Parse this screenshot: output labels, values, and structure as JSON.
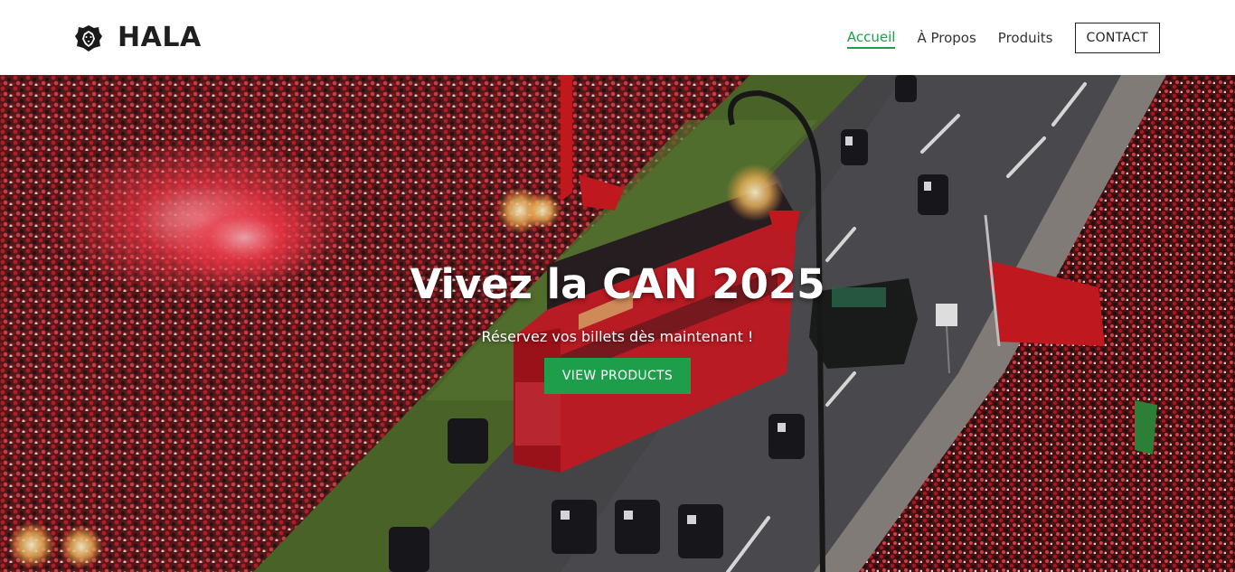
{
  "brand": {
    "name": "HALA",
    "logo_icon": "lion-head-icon"
  },
  "nav": {
    "items": [
      {
        "label": "Accueil",
        "active": true
      },
      {
        "label": "À Propos",
        "active": false
      },
      {
        "label": "Produits",
        "active": false
      }
    ],
    "contact_label": "CONTACT"
  },
  "hero": {
    "title": "Vivez la CAN 2025",
    "subtitle": "Réservez vos billets dès maintenant !",
    "cta_label": "VIEW PRODUCTS",
    "image_description_icon": "parade-photo"
  },
  "colors": {
    "accent": "#1e9e4a",
    "text": "#222222",
    "header_bg": "#ffffff"
  }
}
